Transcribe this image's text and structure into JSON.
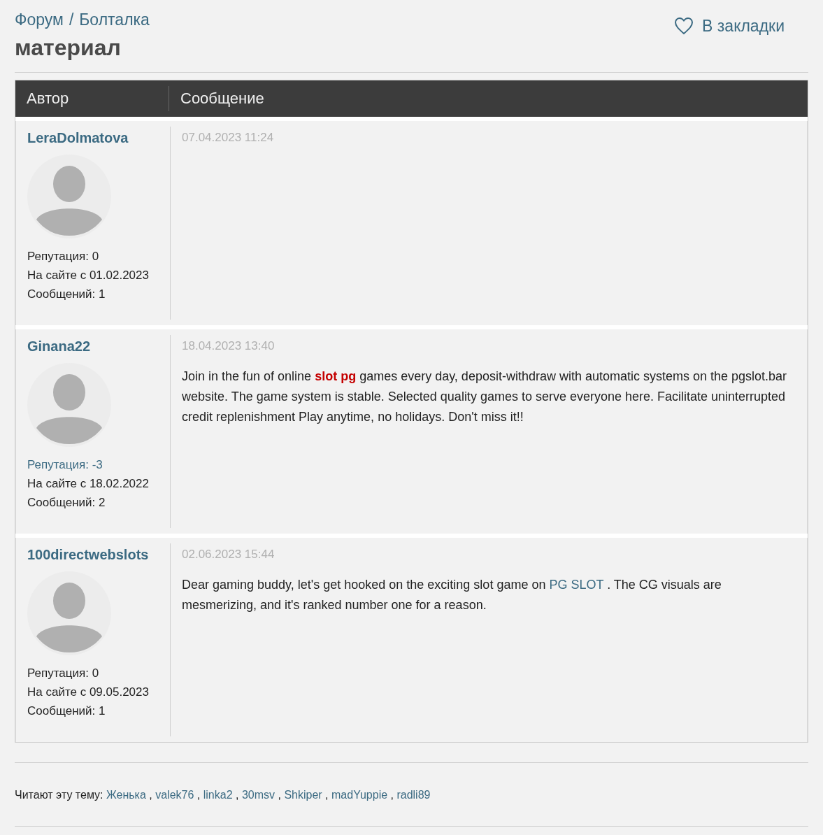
{
  "breadcrumbs": [
    "Форум",
    "Болталка"
  ],
  "breadcrumb_separator": "/",
  "title": "материал",
  "bookmark": {
    "label": "В закладки",
    "bookmarked": false
  },
  "table": {
    "columns": [
      "Автор",
      "Сообщение"
    ],
    "posts": [
      {
        "author": "LeraDolmatova",
        "reputation": {
          "text": "Репутация: 0",
          "negative": false
        },
        "since": "На сайте с 01.02.2023",
        "messages": "Сообщений: 1",
        "date": "07.04.2023 11:24"
      },
      {
        "author": "Ginana22",
        "reputation": {
          "text": "Репутация: -3",
          "negative": true
        },
        "since": "На сайте с 18.02.2022",
        "messages": "Сообщений: 2",
        "date": "18.04.2023 13:40",
        "body": [
          {
            "kind": "text",
            "text": "Join in the fun of online "
          },
          {
            "kind": "highlight",
            "text": "slot pg"
          },
          {
            "kind": "text",
            "text": " games every day, deposit-withdraw with automatic systems on the pgslot.bar website. The game system is stable. Selected quality games to serve everyone here. Facilitate uninterrupted credit replenishment Play anytime, no holidays. Don't miss it!!"
          }
        ]
      },
      {
        "author": "100directwebslots",
        "reputation": {
          "text": "Репутация: 0",
          "negative": false
        },
        "since": "На сайте с 09.05.2023",
        "messages": "Сообщений: 1",
        "date": "02.06.2023 15:44",
        "body": [
          {
            "kind": "text",
            "text": "Dear gaming buddy, let's get hooked on the exciting slot game on "
          },
          {
            "kind": "link",
            "text": "PG SLOT"
          },
          {
            "kind": "text",
            "text": " . The CG visuals are mesmerizing, and it's ranked number one for a reason."
          }
        ]
      }
    ]
  },
  "readers": {
    "label": "Читают эту тему:",
    "separator": ",",
    "names": [
      "Женька",
      "valek76",
      "linka2",
      "30msv",
      "Shkiper",
      "madYuppie",
      "radli89"
    ]
  }
}
